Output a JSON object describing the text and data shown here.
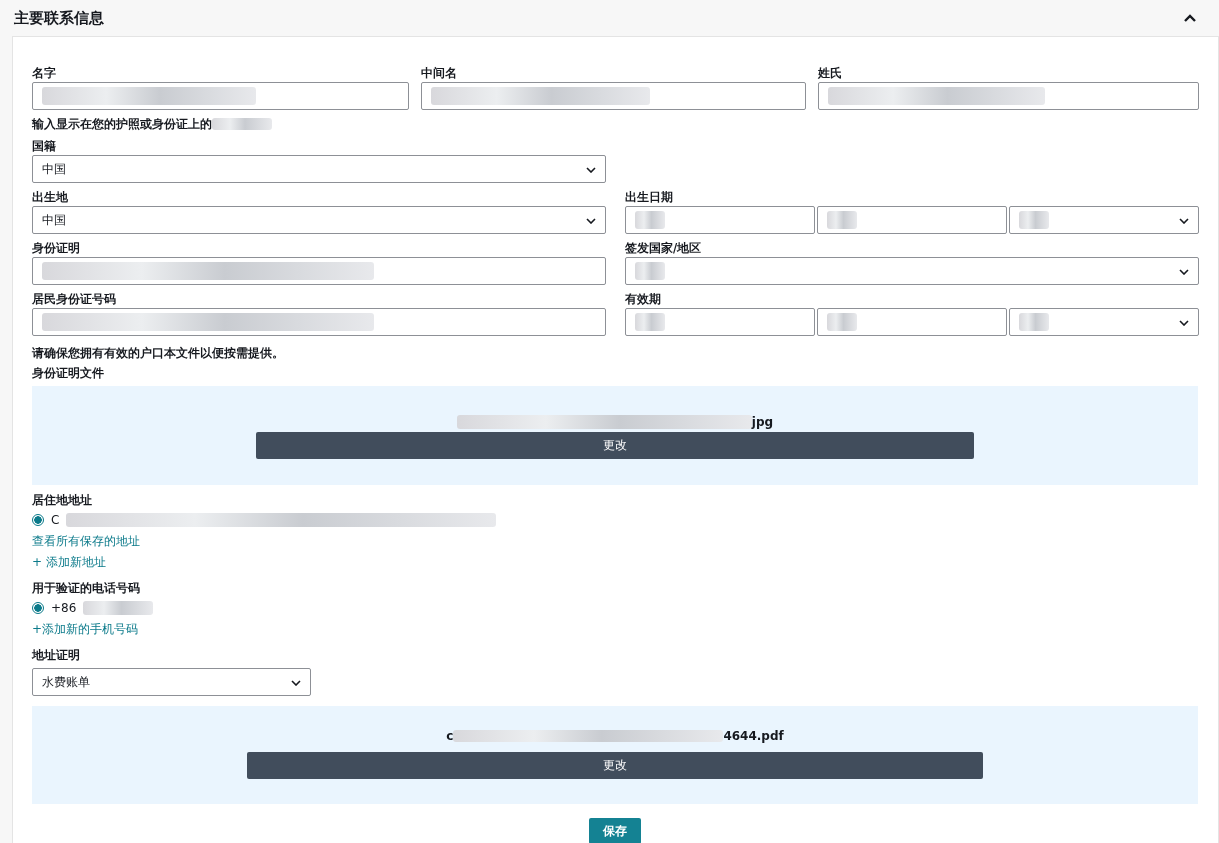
{
  "header": {
    "title": "主要联系信息",
    "expanded": true
  },
  "name_fields": [
    {
      "label": "名字",
      "redacted": true
    },
    {
      "label": "中间名",
      "redacted": true
    },
    {
      "label": "姓氏",
      "redacted": true
    }
  ],
  "name_hint": {
    "text": "输入显示在您的护照或身份证上的",
    "redacted": true
  },
  "rows": [
    {
      "left": {
        "kind": "select",
        "label": "国籍",
        "value": "中国"
      }
    },
    {
      "left": {
        "kind": "select",
        "label": "出生地",
        "value": "中国"
      },
      "right": {
        "kind": "date",
        "label": "出生日期",
        "redacted": true
      }
    },
    {
      "left": {
        "kind": "input",
        "label": "身份证明",
        "redacted": true
      },
      "right": {
        "kind": "select",
        "label": "签发国家/地区",
        "redacted": true
      }
    },
    {
      "left": {
        "kind": "input",
        "label": "居民身份证号码",
        "redacted": true
      },
      "right": {
        "kind": "date",
        "label": "有效期",
        "redacted": true
      }
    }
  ],
  "note": "请确保您拥有有效的户口本文件以便按需提供。",
  "id_document": {
    "label": "身份证明文件",
    "file_suffix": "jpg",
    "button": "更改"
  },
  "address": {
    "label": "居住地地址",
    "options": [
      {
        "text": "C",
        "selected": true
      }
    ],
    "links": [
      "查看所有保存的地址",
      "+ 添加新地址"
    ]
  },
  "phone": {
    "label": "用于验证的电话号码",
    "options": [
      {
        "text": "+86",
        "selected": true
      }
    ],
    "links": [
      "+添加新的手机号码"
    ]
  },
  "address_proof": {
    "label": "地址证明",
    "value": "水费账单",
    "file_prefix": "c",
    "file_suffix": "4644.pdf",
    "button": "更改"
  },
  "save_button": "保存"
}
